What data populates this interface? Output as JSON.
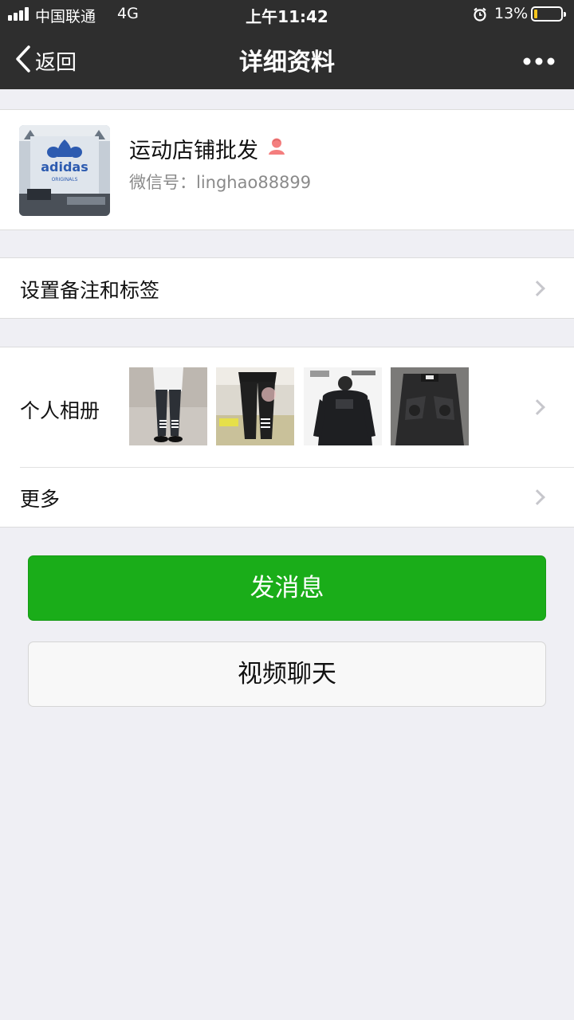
{
  "status_bar": {
    "carrier": "中国联通",
    "network": "4G",
    "time": "上午11:42",
    "battery_percent": "13%",
    "battery_level": 0.13,
    "icons": [
      "signal-icon",
      "alarm-icon",
      "battery-icon"
    ]
  },
  "nav": {
    "back_label": "返回",
    "title": "详细资料",
    "more_icon": "more-dots-icon"
  },
  "profile": {
    "name": "运动店铺批发",
    "wechat_id_label": "微信号：",
    "wechat_id": "linghao88899",
    "avatar_brand": "adidas",
    "avatar_sub": "ORIGINALS",
    "gender_icon": "female-icon"
  },
  "rows": {
    "remark_label": "设置备注和标签",
    "album_label": "个人相册",
    "more_label": "更多"
  },
  "buttons": {
    "message": "发消息",
    "video_chat": "视频聊天"
  },
  "colors": {
    "nav_bg": "#2e2e2e",
    "primary_green": "#1aad19",
    "page_bg": "#efeff4",
    "female_icon": "#f47e7e"
  }
}
